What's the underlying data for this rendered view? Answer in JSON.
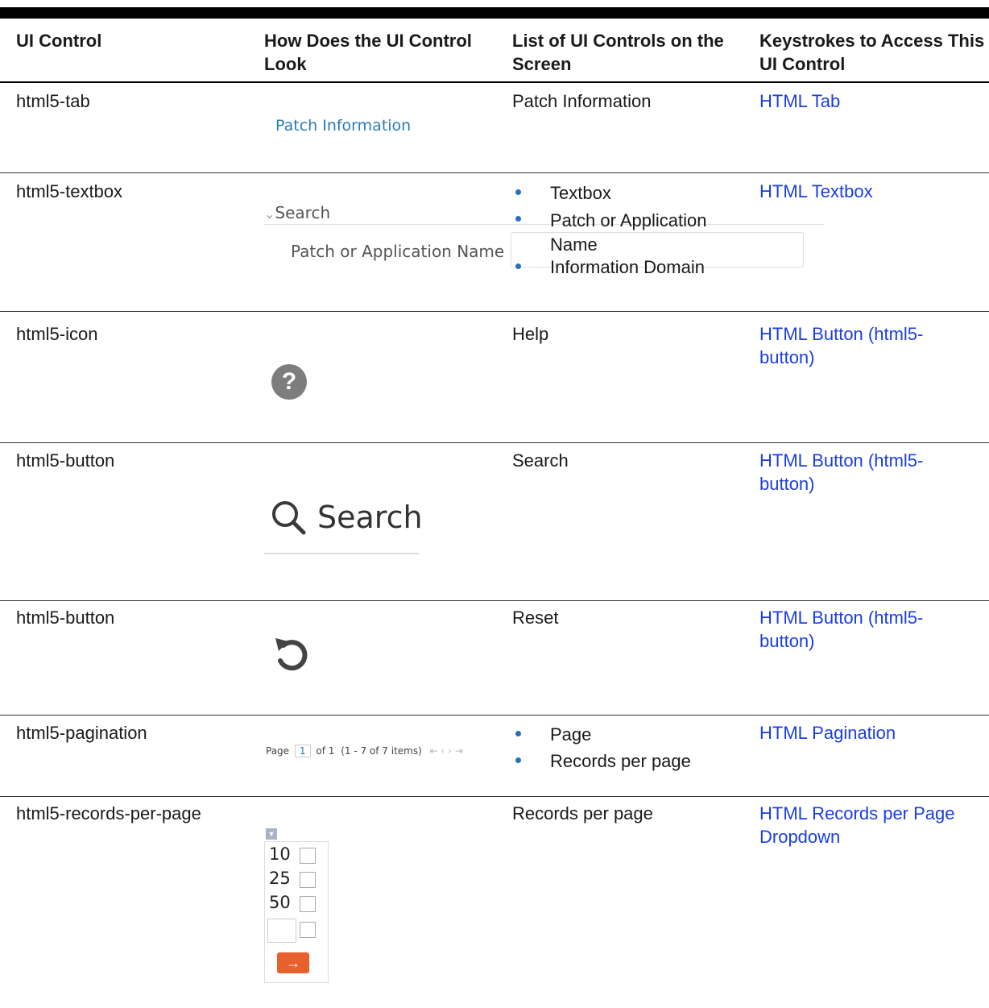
{
  "headers": {
    "col1": "UI Control",
    "col2": "How Does the UI Control Look",
    "col3": "List of UI Controls on the Screen",
    "col4": "Keystrokes to Access This UI Control"
  },
  "rows": [
    {
      "control": "html5-tab",
      "controls": "Patch Information",
      "keystrokes": "HTML Tab",
      "preview": {
        "tab_label": "Patch Information"
      }
    },
    {
      "control": "html5-textbox",
      "bullets": [
        "Textbox",
        "Patch or Application Name",
        "Information Domain"
      ],
      "keystrokes": "HTML Textbox",
      "preview": {
        "section_label": "Search",
        "field_label": "Patch or Application Name"
      }
    },
    {
      "control": "html5-icon",
      "controls": "Help",
      "keystrokes": "HTML Button (html5-button)",
      "preview": {
        "icon": "help-icon",
        "glyph": "?"
      }
    },
    {
      "control": "html5-button",
      "controls": "Search",
      "keystrokes": "HTML Button (html5-button)",
      "preview": {
        "label": "Search",
        "icon": "search-icon"
      }
    },
    {
      "control": "html5-button",
      "controls": "Reset",
      "keystrokes": "HTML Button (html5-button)",
      "preview": {
        "icon": "reset-icon"
      }
    },
    {
      "control": "html5-pagination",
      "bullets": [
        "Page",
        "Records per page"
      ],
      "keystrokes": "HTML Pagination",
      "preview": {
        "page_label": "Page",
        "page_value": "1",
        "of_label": "of 1",
        "items_label": "(1 - 7 of  7  items)"
      }
    },
    {
      "control": "html5-records-per-page",
      "controls": "Records per page",
      "keystrokes": "HTML Records per Page Dropdown",
      "preview": {
        "options": [
          "10",
          "25",
          "50"
        ]
      }
    }
  ],
  "colors": {
    "link": "#1a3de6",
    "bullet": "#2a6ebb",
    "help_icon": "#7d7d7d",
    "go_button": "#e8612c"
  }
}
